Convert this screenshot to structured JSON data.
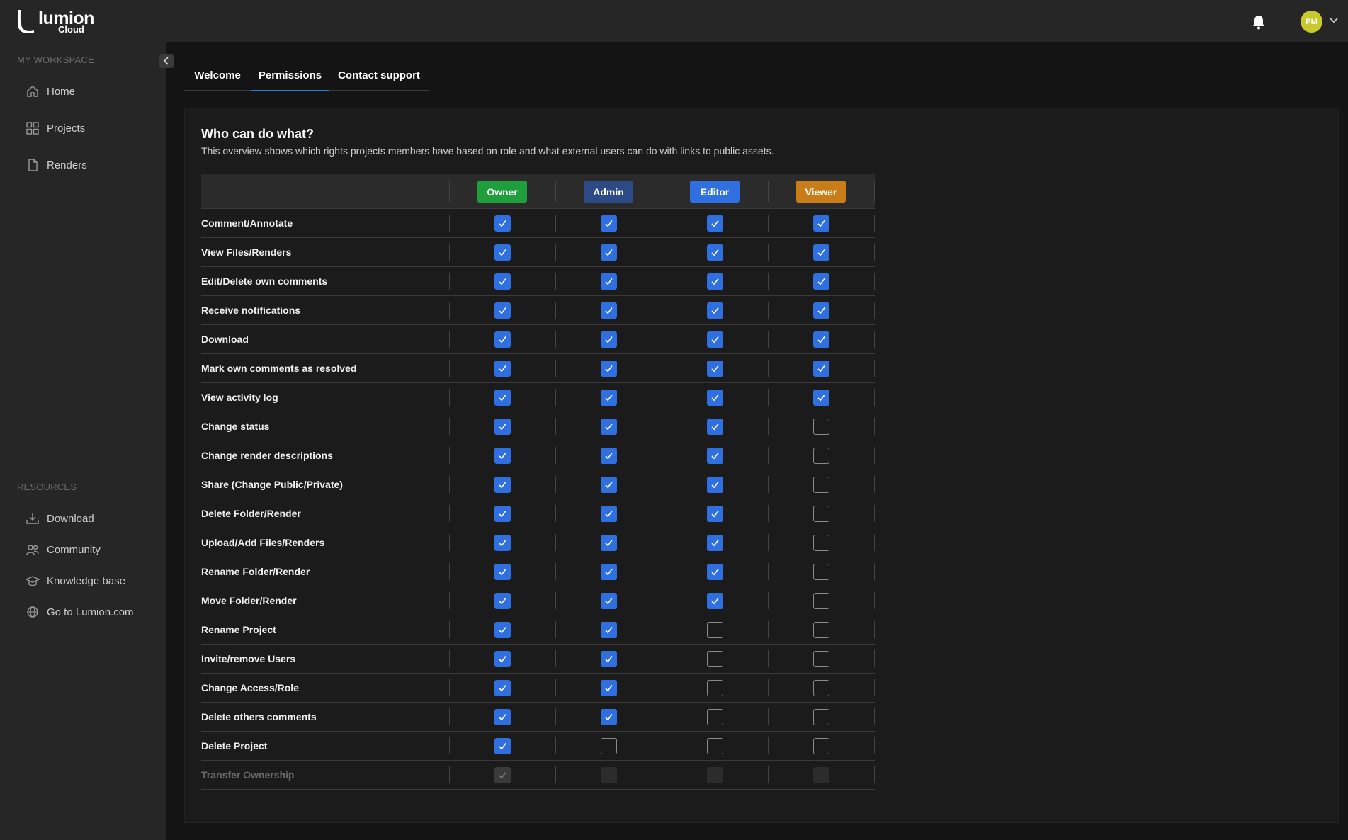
{
  "app": {
    "logo_text": "lumion",
    "logo_sub": "Cloud",
    "user_initials": "PM"
  },
  "sidebar": {
    "workspace_label": "MY WORKSPACE",
    "workspace_items": [
      {
        "label": "Home",
        "icon": "home-icon"
      },
      {
        "label": "Projects",
        "icon": "grid-icon"
      },
      {
        "label": "Renders",
        "icon": "file-icon"
      }
    ],
    "resources_label": "RESOURCES",
    "resources_items": [
      {
        "label": "Download",
        "icon": "download-icon"
      },
      {
        "label": "Community",
        "icon": "users-icon"
      },
      {
        "label": "Knowledge base",
        "icon": "graduation-cap-icon"
      },
      {
        "label": "Go to Lumion.com",
        "icon": "globe-icon"
      }
    ]
  },
  "tabs": [
    {
      "label": "Welcome",
      "active": false
    },
    {
      "label": "Permissions",
      "active": true
    },
    {
      "label": "Contact support",
      "active": false
    }
  ],
  "panel": {
    "title": "Who can do what?",
    "description": "This overview shows which rights projects members have based on role and what external users can do with links to public assets."
  },
  "roles": [
    {
      "label": "Owner",
      "color": "#1f9e3c"
    },
    {
      "label": "Admin",
      "color": "#2c4a86"
    },
    {
      "label": "Editor",
      "color": "#2f6fe0"
    },
    {
      "label": "Viewer",
      "color": "#c87d18"
    }
  ],
  "permissions": [
    {
      "label": "Comment/Annotate",
      "values": [
        true,
        true,
        true,
        true
      ]
    },
    {
      "label": "View Files/Renders",
      "values": [
        true,
        true,
        true,
        true
      ]
    },
    {
      "label": "Edit/Delete own comments",
      "values": [
        true,
        true,
        true,
        true
      ]
    },
    {
      "label": "Receive notifications",
      "values": [
        true,
        true,
        true,
        true
      ]
    },
    {
      "label": "Download",
      "values": [
        true,
        true,
        true,
        true
      ]
    },
    {
      "label": "Mark own comments as resolved",
      "values": [
        true,
        true,
        true,
        true
      ]
    },
    {
      "label": "View activity log",
      "values": [
        true,
        true,
        true,
        true
      ]
    },
    {
      "label": "Change status",
      "values": [
        true,
        true,
        true,
        false
      ]
    },
    {
      "label": "Change render descriptions",
      "values": [
        true,
        true,
        true,
        false
      ]
    },
    {
      "label": "Share (Change Public/Private)",
      "values": [
        true,
        true,
        true,
        false
      ]
    },
    {
      "label": "Delete Folder/Render",
      "values": [
        true,
        true,
        true,
        false
      ]
    },
    {
      "label": "Upload/Add Files/Renders",
      "values": [
        true,
        true,
        true,
        false
      ]
    },
    {
      "label": "Rename Folder/Render",
      "values": [
        true,
        true,
        true,
        false
      ]
    },
    {
      "label": "Move Folder/Render",
      "values": [
        true,
        true,
        true,
        false
      ]
    },
    {
      "label": "Rename Project",
      "values": [
        true,
        true,
        false,
        false
      ]
    },
    {
      "label": "Invite/remove Users",
      "values": [
        true,
        true,
        false,
        false
      ]
    },
    {
      "label": "Change Access/Role",
      "values": [
        true,
        true,
        false,
        false
      ]
    },
    {
      "label": "Delete others comments",
      "values": [
        true,
        true,
        false,
        false
      ]
    },
    {
      "label": "Delete Project",
      "values": [
        true,
        false,
        false,
        false
      ]
    },
    {
      "label": "Transfer Ownership",
      "values": [
        true,
        false,
        false,
        false
      ],
      "disabled": true
    }
  ]
}
